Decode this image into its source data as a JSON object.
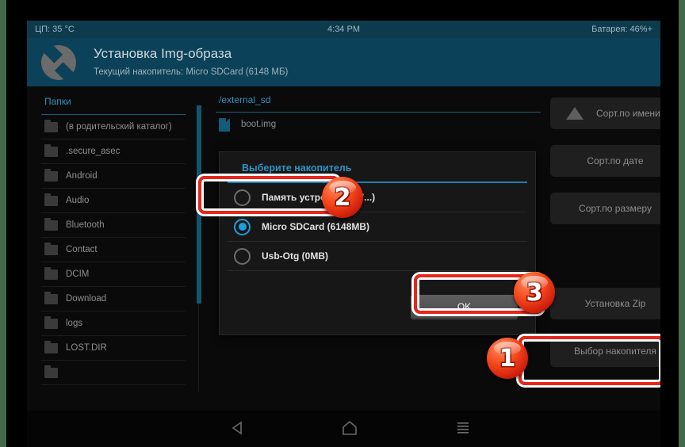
{
  "statusbar": {
    "cpu": "ЦП: 35 °C",
    "time": "4:34 PM",
    "battery": "Батарея: 46%+"
  },
  "header": {
    "title": "Установка Img-образа",
    "subtitle": "Текущий накопитель: Micro SDCard (6148 МБ)",
    "logo_icon": "flashify-logo-icon"
  },
  "folders": {
    "heading": "Папки",
    "items": [
      {
        "label": "(в родительский каталог)"
      },
      {
        "label": ".secure_asec"
      },
      {
        "label": "Android"
      },
      {
        "label": "Audio"
      },
      {
        "label": "Bluetooth"
      },
      {
        "label": "Contact"
      },
      {
        "label": "DCIM"
      },
      {
        "label": "Download"
      },
      {
        "label": "logs"
      },
      {
        "label": "LOST.DIR"
      },
      {
        "label": ""
      }
    ]
  },
  "filepanel": {
    "path": "/external_sd",
    "files": [
      {
        "label": "boot.img"
      }
    ]
  },
  "dialog": {
    "title": "Выберите накопитель",
    "options": [
      {
        "label": "Память устройства (7...)",
        "checked": false
      },
      {
        "label": "Micro SDCard (6148MB)",
        "checked": true
      },
      {
        "label": "Usb-Otg (0MB)",
        "checked": false
      }
    ],
    "ok_label": "OK"
  },
  "actions": [
    {
      "label": "Сорт.по имени",
      "icon": "sort-ascending-triangle-icon"
    },
    {
      "label": "Сорт.по дате",
      "icon": ""
    },
    {
      "label": "Сорт.по размеру",
      "icon": ""
    },
    {
      "label": "Установка Zip",
      "icon": ""
    },
    {
      "label": "Выбор накопителя",
      "icon": ""
    }
  ],
  "badges": [
    {
      "number": "1"
    },
    {
      "number": "2"
    },
    {
      "number": "3"
    }
  ],
  "navbar": {
    "back_icon": "back-triangle-icon",
    "home_icon": "home-icon",
    "recents_icon": "recents-menu-icon"
  },
  "colors": {
    "accent_blue": "#2e93c4",
    "header_blue": "#0b4159",
    "statusbar_blue": "#0d3a4d",
    "highlight_red": "#e8261c",
    "radio_checked": "#1f9fd8",
    "edge_green": "#44684a"
  }
}
